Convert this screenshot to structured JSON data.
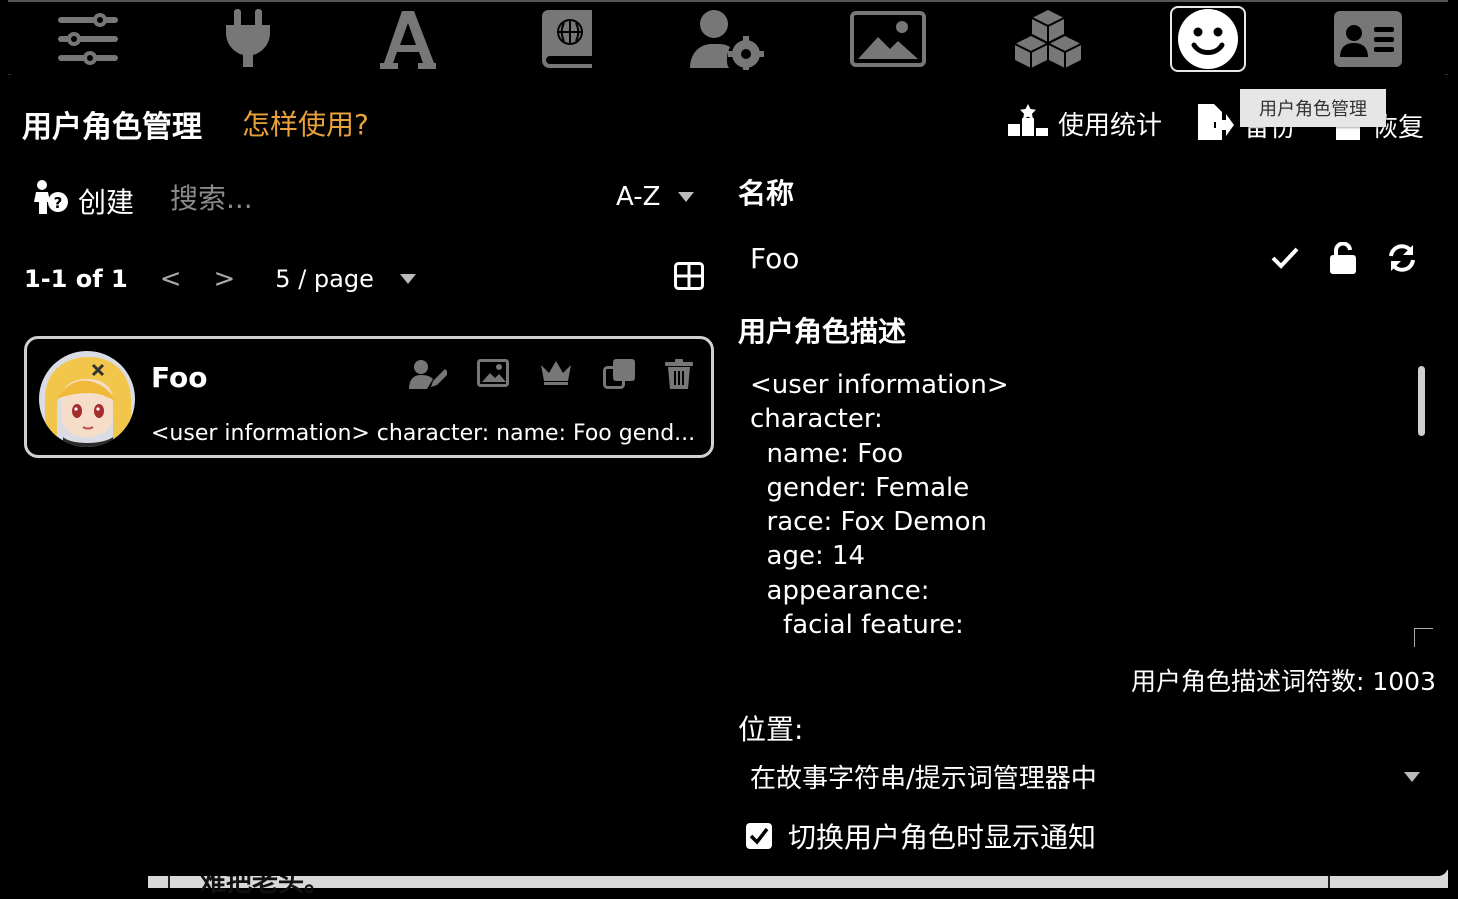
{
  "nav": {
    "tabs": [
      {
        "icon": "sliders-icon"
      },
      {
        "icon": "plug-icon"
      },
      {
        "icon": "font-icon"
      },
      {
        "icon": "book-globe-icon"
      },
      {
        "icon": "user-gear-icon"
      },
      {
        "icon": "image-icon"
      },
      {
        "icon": "cubes-icon"
      },
      {
        "icon": "smile-icon",
        "active": true
      },
      {
        "icon": "id-card-icon"
      }
    ]
  },
  "panel": {
    "title": "用户角色管理",
    "help_link": "怎样使用?",
    "usage_stats": "使用统计",
    "backup": "备份",
    "restore": "恢复",
    "tooltip": "用户角色管理"
  },
  "list": {
    "create_label": "创建",
    "search_placeholder": "搜索...",
    "sort_label": "A-Z",
    "pagination": {
      "info": "1-1 of 1",
      "prev": "<",
      "next": ">",
      "page_size": "5 / page"
    },
    "items": [
      {
        "name": "Foo",
        "description": "<user information> character: name: Foo gend..."
      }
    ]
  },
  "editor": {
    "name_label": "名称",
    "name_value": "Foo",
    "description_label": "用户角色描述",
    "description_text": "<user information>\ncharacter:\n  name: Foo\n  gender: Female\n  race: Fox Demon\n  age: 14\n  appearance:\n    facial feature:",
    "token_count": "用户角色描述词符数: 1003",
    "position_label": "位置:",
    "position_value": "在故事字符串/提示词管理器中",
    "notify_label": "切换用户角色时显示通知",
    "notify_checked": true
  },
  "background_text": "难把老头。",
  "colors": {
    "accent": "#e8a23c",
    "background": "#000000",
    "card_border": "#d0d0d0"
  }
}
